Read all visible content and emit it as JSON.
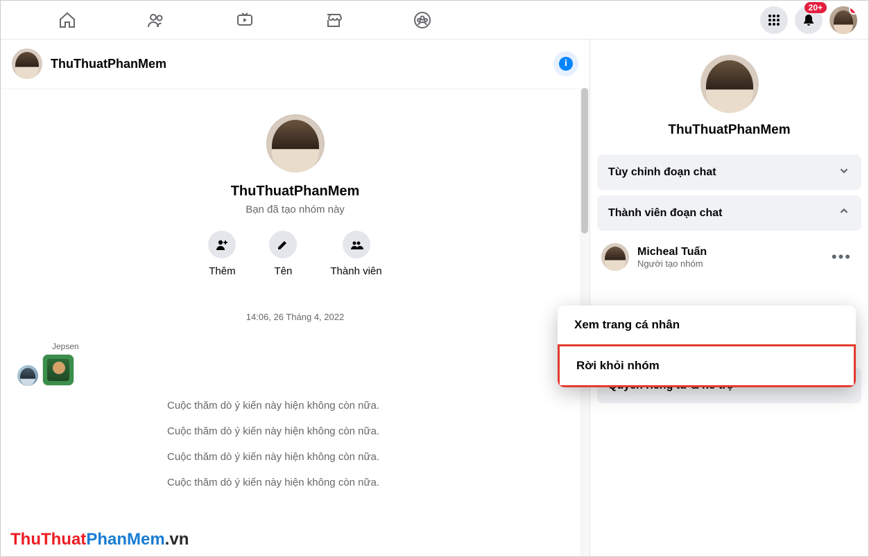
{
  "nav": {
    "notifBadge": "20+"
  },
  "chat": {
    "title": "ThuThuatPhanMem",
    "bigTitle": "ThuThuatPhanMem",
    "subtitle": "Bạn đã tạo nhóm này",
    "actions": {
      "add": "Thêm",
      "name": "Tên",
      "members": "Thành viên"
    },
    "timestamp": "14:06, 26 Tháng 4, 2022",
    "sender": "Jepsen",
    "sysMsgs": [
      "Cuộc thăm dò ý kiến này hiện không còn nữa.",
      "Cuộc thăm dò ý kiến này hiện không còn nữa.",
      "Cuộc thăm dò ý kiến này hiện không còn nữa.",
      "Cuộc thăm dò ý kiến này hiện không còn nữa."
    ]
  },
  "panel": {
    "title": "ThuThuatPhanMem",
    "sections": {
      "customize": "Tùy chỉnh đoạn chat",
      "members": "Thành viên đoạn chat",
      "privacy": "Quyền riêng tư & hỗ trợ"
    },
    "member": {
      "name": "Micheal Tuấn",
      "role": "Người tạo nhóm"
    }
  },
  "popup": {
    "viewProfile": "Xem trang cá nhân",
    "leaveGroup": "Rời khỏi nhóm"
  },
  "watermark": {
    "p1": "ThuThuat",
    "p2": "PhanMem",
    "p3": ".vn"
  }
}
